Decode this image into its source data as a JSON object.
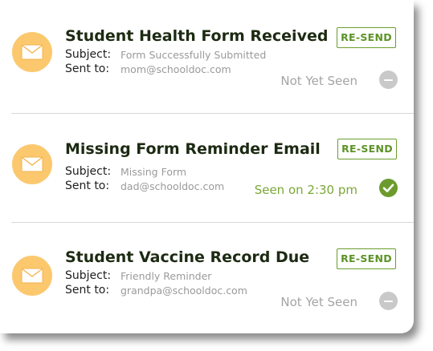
{
  "labels": {
    "subject": "Subject:",
    "sent_to": "Sent to:"
  },
  "notifications": [
    {
      "title": "Student Health Form Received",
      "subject": "Form Successfully Submitted",
      "sent_to": "mom@schooldoc.com",
      "resend_label": "RE-SEND",
      "status": "Not Yet Seen",
      "status_icon": "minus-circle-icon"
    },
    {
      "title": "Missing Form Reminder Email",
      "subject": "Missing Form",
      "sent_to": "dad@schooldoc.com",
      "resend_label": "RE-SEND",
      "status": "Seen on 2:30 pm",
      "status_icon": "check-circle-icon"
    },
    {
      "title": "Student Vaccine Record Due",
      "subject": "Friendly  Reminder",
      "sent_to": "grandpa@schooldoc.com",
      "resend_label": "RE-SEND",
      "status": "Not Yet Seen",
      "status_icon": "minus-circle-icon"
    }
  ],
  "colors": {
    "accent_green": "#6a9e2c",
    "envelope_bg": "#fbc86e",
    "title_text": "#1c2a12",
    "muted_text": "#a4a4a4"
  }
}
